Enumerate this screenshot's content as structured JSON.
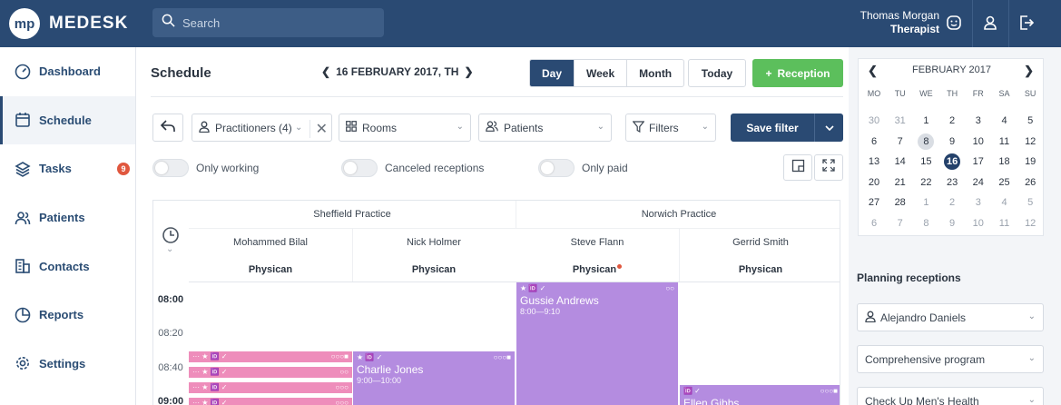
{
  "brand": {
    "logo_mark": "mp",
    "name": "MEDESK"
  },
  "search": {
    "placeholder": "Search"
  },
  "user": {
    "name": "Thomas Morgan",
    "role": "Therapist"
  },
  "sidebar": {
    "items": [
      {
        "label": "Dashboard",
        "icon": "dashboard-icon"
      },
      {
        "label": "Schedule",
        "icon": "calendar-icon",
        "active": true
      },
      {
        "label": "Tasks",
        "icon": "layers-icon",
        "badge": "9"
      },
      {
        "label": "Patients",
        "icon": "users-icon"
      },
      {
        "label": "Contacts",
        "icon": "building-icon"
      },
      {
        "label": "Reports",
        "icon": "pie-chart-icon"
      },
      {
        "label": "Settings",
        "icon": "gear-icon"
      }
    ]
  },
  "schedule": {
    "title": "Schedule",
    "date": "16 FEBRUARY 2017, TH",
    "views": [
      "Day",
      "Week",
      "Month"
    ],
    "today_label": "Today",
    "reception_label": "Reception",
    "filters": {
      "practitioners": "Practitioners (4)",
      "rooms": "Rooms",
      "patients": "Patients",
      "filters": "Filters",
      "save": "Save filter"
    },
    "toggles": [
      "Only working",
      "Canceled receptions",
      "Only paid"
    ],
    "locations": [
      "Sheffield Practice",
      "Norwich Practice"
    ],
    "practitioners": [
      {
        "name": "Mohammed Bilal",
        "specialty": "Physican"
      },
      {
        "name": "Nick Holmer",
        "specialty": "Physican"
      },
      {
        "name": "Steve Flann",
        "specialty": "Physican"
      },
      {
        "name": "Gerrid Smith",
        "specialty": "Physican"
      }
    ],
    "times": [
      "08:00",
      "08:20",
      "08:40",
      "09:00"
    ],
    "appointments": [
      {
        "name": "Gussie Andrews",
        "time": "8:00—9:10"
      },
      {
        "name": "Charlie Jones",
        "time": "9:00—10:00"
      },
      {
        "name": "Ellen Gibbs"
      }
    ]
  },
  "calendar": {
    "month": "FEBRUARY 2017",
    "weekdays": [
      "MO",
      "TU",
      "WE",
      "TH",
      "FR",
      "SA",
      "SU"
    ],
    "weeks": [
      [
        "30",
        "31",
        "1",
        "2",
        "3",
        "4",
        "5"
      ],
      [
        "6",
        "7",
        "8",
        "9",
        "10",
        "11",
        "12"
      ],
      [
        "13",
        "14",
        "15",
        "16",
        "17",
        "18",
        "19"
      ],
      [
        "20",
        "21",
        "22",
        "23",
        "24",
        "25",
        "26"
      ],
      [
        "27",
        "28",
        "1",
        "2",
        "3",
        "4",
        "5"
      ],
      [
        "6",
        "7",
        "8",
        "9",
        "10",
        "11",
        "12"
      ]
    ]
  },
  "planning": {
    "title": "Planning receptions",
    "patient": "Alejandro Daniels",
    "program": "Comprehensive program",
    "checkup": "Check Up Men's Health"
  },
  "colors": {
    "header": "#2a4a73",
    "accent_green": "#5cbf5c",
    "appointment_purple": "#b48ce0",
    "appointment_pink": "#ee8dbb",
    "badge": "#e0573e"
  }
}
